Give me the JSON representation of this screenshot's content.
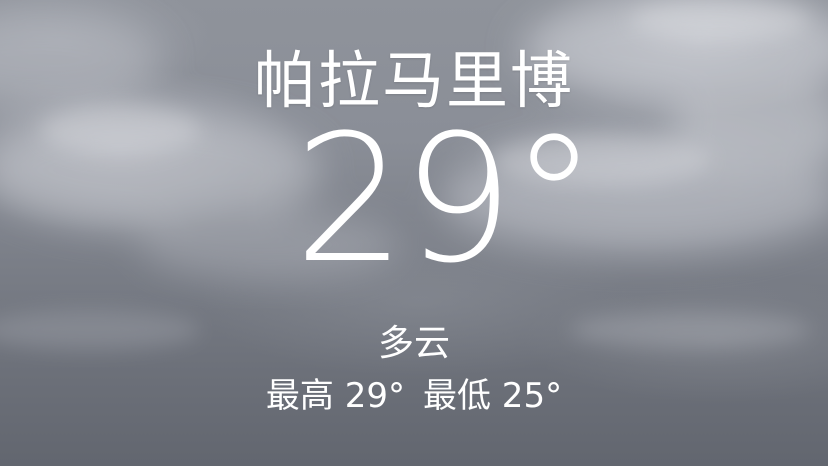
{
  "weather": {
    "city": "帕拉马里博",
    "temperature": "29°",
    "condition": "多云",
    "high": "最高 29°",
    "low": "最低 25°"
  },
  "colors": {
    "text": "#ffffff",
    "sky_top": "#8f939b",
    "sky_bottom": "#62666f"
  }
}
